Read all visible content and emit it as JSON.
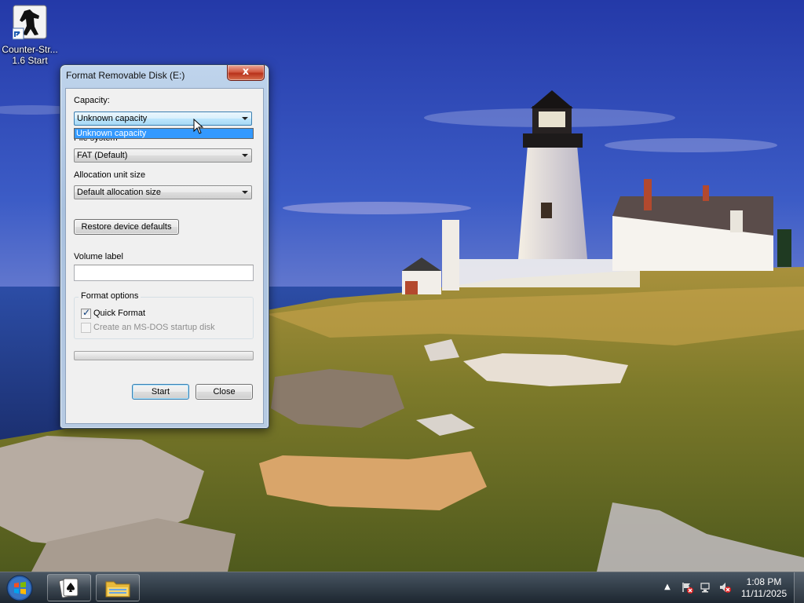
{
  "desktop": {
    "icons": [
      {
        "label_line1": "Counter-Str...",
        "label_line2": "1.6 Start",
        "icon": "counter-strike-shortcut-icon"
      }
    ]
  },
  "dialog": {
    "title": "Format Removable Disk (E:)",
    "close_glyph": "x",
    "capacity": {
      "label": "Capacity:",
      "value": "Unknown capacity",
      "open_option": "Unknown capacity"
    },
    "file_system": {
      "label": "File system",
      "value": "FAT (Default)"
    },
    "allocation": {
      "label": "Allocation unit size",
      "value": "Default allocation size"
    },
    "restore_button": "Restore device defaults",
    "volume_label": {
      "label": "Volume label",
      "value": ""
    },
    "format_options": {
      "title": "Format options",
      "quick_format": {
        "label": "Quick Format",
        "checked": true
      },
      "msdos_disk": {
        "label": "Create an MS-DOS startup disk",
        "checked": false,
        "enabled": false
      }
    },
    "progress": 0,
    "start_button": "Start",
    "close_button": "Close"
  },
  "taskbar": {
    "pinned": [
      {
        "icon": "solitaire-icon"
      },
      {
        "icon": "file-explorer-icon"
      }
    ],
    "tray": {
      "time": "1:08 PM",
      "date": "11/11/2025",
      "icons": [
        "show-hidden-icons-icon",
        "action-center-icon",
        "network-icon",
        "volume-muted-icon"
      ]
    }
  },
  "colors": {
    "selection": "#3399ff",
    "taskbar": "#1c2a36"
  }
}
